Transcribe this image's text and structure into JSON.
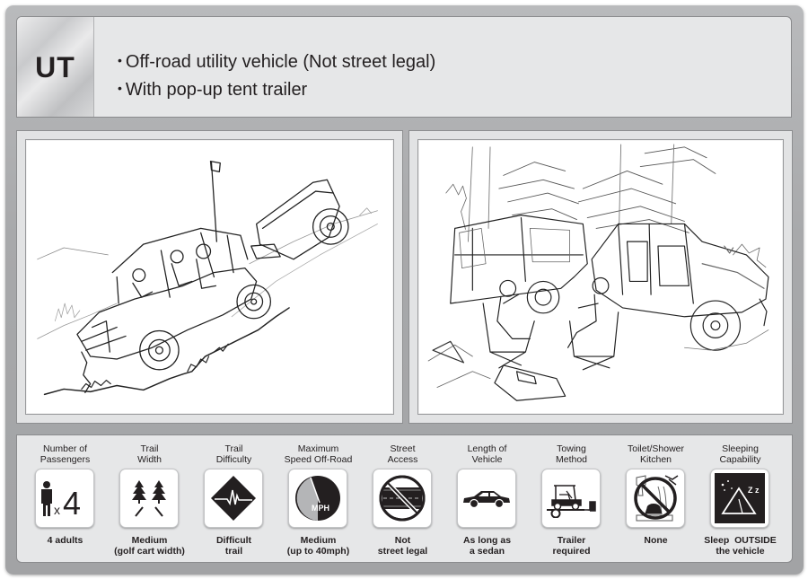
{
  "header": {
    "code": "UT",
    "bullets": [
      "Off-road utility vehicle (Not street legal)",
      "With pop-up tent trailer"
    ]
  },
  "illustrations": [
    {
      "name": "utv-towing-trailer-uphill",
      "description": "Off-road utility vehicle with passengers towing a pop-up tent trailer up a hill"
    },
    {
      "name": "campsite-scene",
      "description": "Two people in camping chairs beside a popped-up tent trailer and parked utility vehicle among trees"
    }
  ],
  "specs": [
    {
      "label_line1": "Number of",
      "label_line2": "Passengers",
      "icon": "passengers-x4-icon",
      "icon_text": "x4",
      "value_line1": "4 adults",
      "value_line2": ""
    },
    {
      "label_line1": "Trail",
      "label_line2": "Width",
      "icon": "trail-width-trees-icon",
      "value_line1": "Medium",
      "value_line2": "(golf cart width)"
    },
    {
      "label_line1": "Trail",
      "label_line2": "Difficulty",
      "icon": "trail-difficulty-diamond-icon",
      "value_line1": "Difficult",
      "value_line2": "trail"
    },
    {
      "label_line1": "Maximum",
      "label_line2": "Speed Off-Road",
      "icon": "speedometer-icon",
      "icon_text": "MPH",
      "value_line1": "Medium",
      "value_line2": "(up to 40mph)"
    },
    {
      "label_line1": "Street",
      "label_line2": "Access",
      "icon": "no-street-icon",
      "value_line1": "Not",
      "value_line2": "street legal"
    },
    {
      "label_line1": "Length of",
      "label_line2": "Vehicle",
      "icon": "sedan-car-icon",
      "value_line1": "As long as",
      "value_line2": "a sedan"
    },
    {
      "label_line1": "Towing",
      "label_line2": "Method",
      "icon": "trailer-tow-icon",
      "value_line1": "Trailer",
      "value_line2": "required"
    },
    {
      "label_line1": "Toilet/Shower",
      "label_line2": "Kitchen",
      "icon": "no-facilities-icon",
      "value_line1": "None",
      "value_line2": ""
    },
    {
      "label_line1": "Sleeping",
      "label_line2": "Capability",
      "icon": "tent-night-icon",
      "icon_text": "Z z",
      "value_line1": "Sleep  OUTSIDE",
      "value_line2": "the vehicle"
    }
  ]
}
